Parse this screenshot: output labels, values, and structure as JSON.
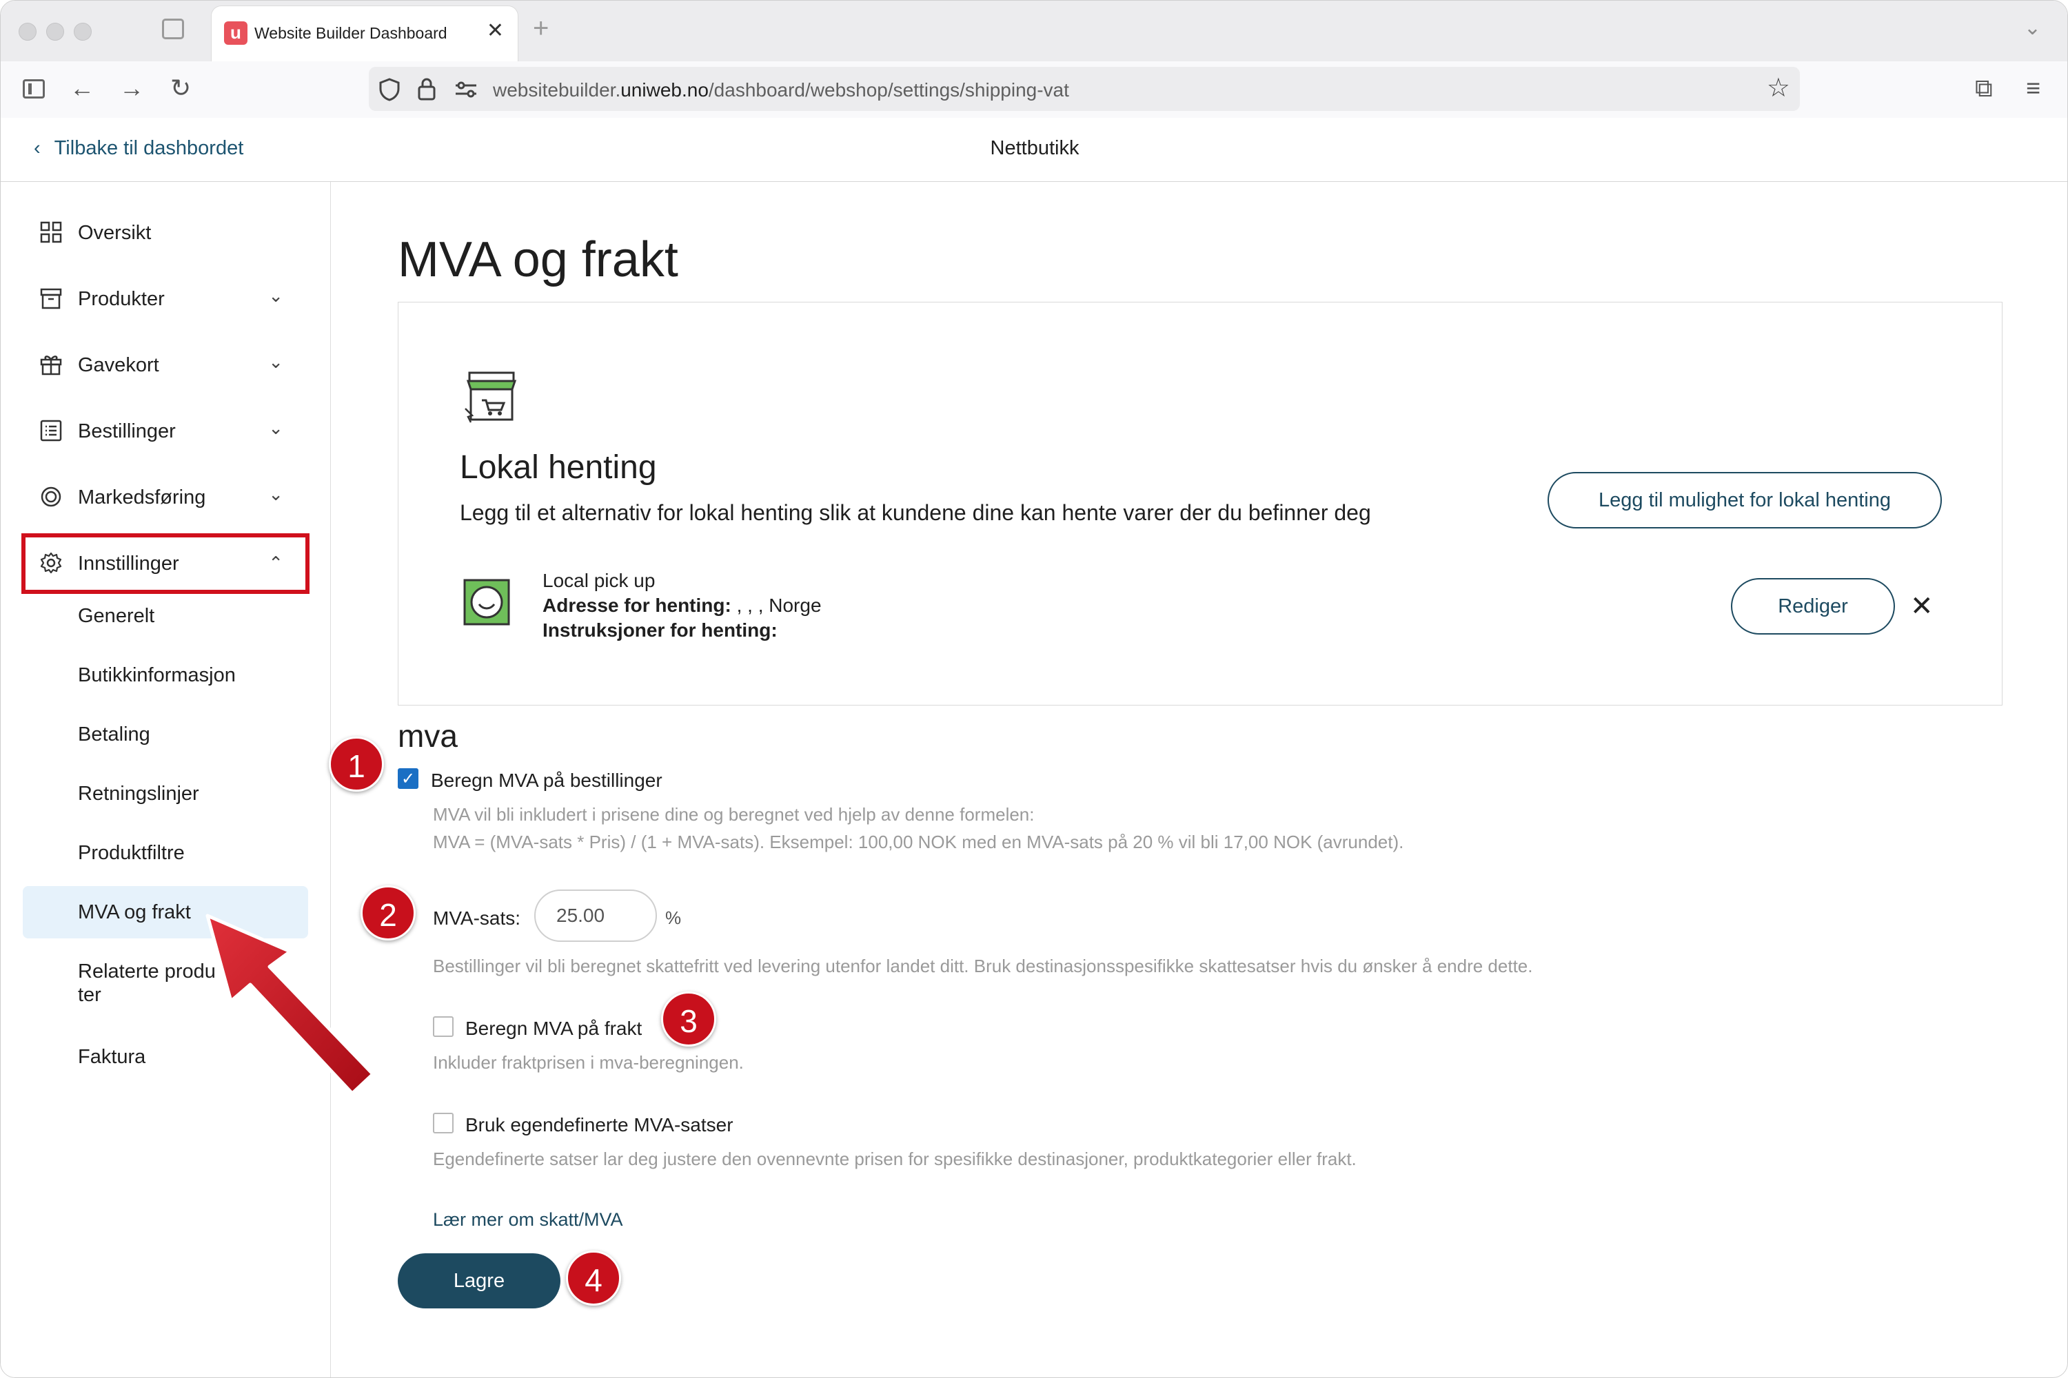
{
  "browser": {
    "tab_title": "Website Builder Dashboard",
    "favicon_letter": "u",
    "url_prefix": "websitebuilder.",
    "url_domain": "uniweb.no",
    "url_path": "/dashboard/webshop/settings/shipping-vat"
  },
  "header": {
    "back_label": "Tilbake til dashbordet",
    "title": "Nettbutikk"
  },
  "sidebar": {
    "items": [
      {
        "label": "Oversikt",
        "icon": "grid-icon"
      },
      {
        "label": "Produkter",
        "icon": "box-icon"
      },
      {
        "label": "Gavekort",
        "icon": "gift-icon"
      },
      {
        "label": "Bestillinger",
        "icon": "list-icon"
      },
      {
        "label": "Markedsføring",
        "icon": "target-icon"
      },
      {
        "label": "Innstillinger",
        "icon": "gear-icon"
      }
    ],
    "sub_items": [
      "Generelt",
      "Butikkinformasjon",
      "Betaling",
      "Retningslinjer",
      "Produktfiltre",
      "MVA og frakt",
      "Relaterte produ",
      "ter",
      "Faktura"
    ]
  },
  "main": {
    "title": "MVA og frakt",
    "local_pickup": {
      "heading": "Lokal henting",
      "description": "Legg til et alternativ for lokal henting slik at kundene dine kan hente varer der du befinner deg",
      "add_button": "Legg til mulighet for lokal henting",
      "entry_name": "Local pick up",
      "address_label": "Adresse for henting:",
      "address_value": " , , , Norge",
      "instructions_label": "Instruksjoner for henting:",
      "edit_button": "Rediger"
    },
    "vat": {
      "heading": "mva",
      "calc_vat_label": "Beregn MVA på bestillinger",
      "calc_vat_checked": true,
      "help_line1": "MVA vil bli inkludert i prisene dine og beregnet ved hjelp av denne formelen:",
      "help_line2": "MVA = (MVA-sats * Pris) / (1 + MVA-sats). Eksempel: 100,00 NOK med en MVA-sats på 20 % vil bli 17,00 NOK (avrundet).",
      "rate_label": "MVA-sats:",
      "rate_value": "25.00",
      "rate_unit": "%",
      "rate_help": "Bestillinger vil bli beregnet skattefritt ved levering utenfor landet ditt. Bruk destinasjonsspesifikke skattesatser hvis du ønsker å endre dette.",
      "shipping_vat_label": "Beregn MVA på frakt",
      "shipping_vat_checked": false,
      "shipping_vat_help": "Inkluder fraktprisen i mva-beregningen.",
      "custom_rates_label": "Bruk egendefinerte MVA-satser",
      "custom_rates_checked": false,
      "custom_rates_help": "Egendefinerte satser lar deg justere den ovennevnte prisen for spesifikke destinasjoner, produktkategorier eller frakt.",
      "learn_more": "Lær mer om skatt/MVA",
      "save_button": "Lagre"
    }
  },
  "annotations": {
    "badges": [
      "1",
      "2",
      "3",
      "4"
    ],
    "accent_color": "#c8101c"
  },
  "colors": {
    "primary": "#1d4a60",
    "checkbox": "#1a6fc4",
    "active_bg": "#e6f2fb"
  }
}
